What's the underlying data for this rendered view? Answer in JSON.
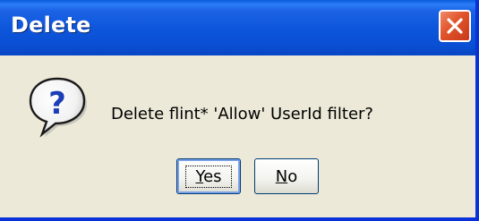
{
  "dialog": {
    "title": "Delete",
    "message": "Delete flint* 'Allow' UserId filter?",
    "icon": "question-icon",
    "close_icon": "close-icon",
    "accent_color": "#0a4fd4",
    "close_color": "#e0532a"
  },
  "buttons": {
    "yes": {
      "mnemonic": "Y",
      "rest": "es"
    },
    "no": {
      "mnemonic": "N",
      "rest": "o"
    }
  }
}
